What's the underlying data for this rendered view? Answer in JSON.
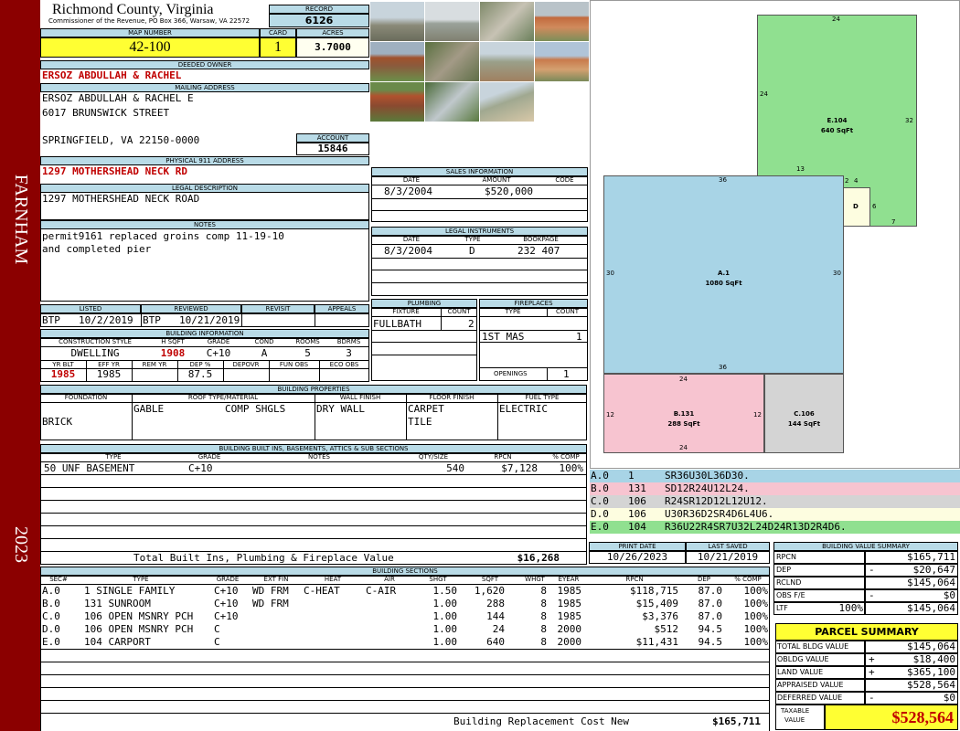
{
  "county": "Richmond County, Virginia",
  "commissioner": "Commissioner of the Revenue, PO Box 366, Warsaw, VA 22572",
  "side_district": "FARNHAM",
  "side_year": "2023",
  "record": {
    "label": "RECORD",
    "value": "6126"
  },
  "map_number": {
    "label": "MAP NUMBER",
    "value": "42-100"
  },
  "card": {
    "label": "CARD",
    "value": "1"
  },
  "acres": {
    "label": "ACRES",
    "value": "3.7000"
  },
  "deeded_owner": {
    "label": "DEEDED OWNER",
    "value": "ERSOZ ABDULLAH & RACHEL"
  },
  "mailing_address": {
    "label": "MAILING ADDRESS",
    "line1": "ERSOZ ABDULLAH & RACHEL E",
    "line2": "6017 BRUNSWICK STREET",
    "line3": "SPRINGFIELD, VA 22150-0000"
  },
  "account": {
    "label": "ACCOUNT",
    "value": "15846"
  },
  "physical_address": {
    "label": "PHYSICAL 911 ADDRESS",
    "value": "1297 MOTHERSHEAD NECK RD"
  },
  "legal_description": {
    "label": "LEGAL DESCRIPTION",
    "value": "1297 MOTHERSHEAD NECK ROAD"
  },
  "notes": {
    "label": "NOTES",
    "line1": "permit9161 replaced groins comp 11-19-10",
    "line2": "and completed pier"
  },
  "sales": {
    "label": "SALES INFORMATION",
    "headers": [
      "DATE",
      "AMOUNT",
      "CODE"
    ],
    "rows": [
      {
        "date": "8/3/2004",
        "amount": "$520,000",
        "code": ""
      }
    ]
  },
  "legal_instruments": {
    "label": "LEGAL INSTRUMENTS",
    "headers": [
      "DATE",
      "TYPE",
      "BOOKPAGE"
    ],
    "rows": [
      {
        "date": "8/3/2004",
        "type": "D",
        "bookpage": "232 407"
      }
    ]
  },
  "plumbing": {
    "label": "PLUMBING",
    "headers": [
      "FIXTURE",
      "COUNT"
    ],
    "fixture": "FULLBATH",
    "count": "2"
  },
  "fireplaces": {
    "label": "FIREPLACES",
    "headers": [
      "TYPE",
      "COUNT"
    ],
    "type": "1ST MAS",
    "count": "1",
    "openings_label": "OPENINGS",
    "openings": "1"
  },
  "review": {
    "headers": [
      "LISTED",
      "REVIEWED",
      "REVISIT",
      "APPEALS"
    ],
    "listed_by": "BTP",
    "listed_date": "10/2/2019",
    "reviewed_by": "BTP",
    "reviewed_date": "10/21/2019",
    "revisit": "",
    "appeals": ""
  },
  "building_info": {
    "label": "BUILDING INFORMATION",
    "headers1": [
      "CONSTRUCTION STYLE",
      "H SQFT",
      "GRADE",
      "COND",
      "ROOMS",
      "BDRMS"
    ],
    "style": "DWELLING",
    "hsqft": "1908",
    "grade": "C+10",
    "cond": "A",
    "rooms": "5",
    "bdrms": "3",
    "headers2": [
      "YR BLT",
      "EFF YR",
      "REM YR",
      "DEP %",
      "DEPOVR",
      "FUN OBS",
      "ECO OBS"
    ],
    "yr_blt": "1985",
    "eff_yr": "1985",
    "rem_yr": "",
    "dep": "87.5",
    "depovr": "",
    "fun_obs": "",
    "eco_obs": ""
  },
  "building_properties": {
    "label": "BUILDING PROPERTIES",
    "headers": [
      "FOUNDATION",
      "ROOF TYPE/MATERIAL",
      "WALL FINISH",
      "FLOOR FINISH",
      "FUEL TYPE"
    ],
    "foundation": "BRICK",
    "roof_type": "GABLE",
    "roof_material": "COMP SHGLS",
    "wall": "DRY WALL",
    "floor1": "CARPET",
    "floor2": "TILE",
    "fuel": "ELECTRIC"
  },
  "builtins": {
    "label": "BUILDING BUILT INS, BASEMENTS, ATTICS & SUB SECTIONS",
    "headers": [
      "TYPE",
      "GRADE",
      "NOTES",
      "QTY/SIZE",
      "RPCN",
      "% COMP"
    ],
    "rows": [
      {
        "type": "50 UNF BASEMENT",
        "grade": "C+10",
        "notes": "",
        "qty": "540",
        "rpcn": "$7,128",
        "comp": "100%"
      }
    ],
    "total_label": "Total Built Ins, Plumbing & Fireplace Value",
    "total_value": "$16,268"
  },
  "sketch_legend": [
    {
      "code": "A.0",
      "num": "1",
      "desc": "SR36U30L36D30.",
      "color": "#a8d4e6"
    },
    {
      "code": "B.0",
      "num": "131",
      "desc": "SD12R24U12L24.",
      "color": "#f7c4d0"
    },
    {
      "code": "C.0",
      "num": "106",
      "desc": "R24SR12D12L12U12.",
      "color": "#d4d4d4"
    },
    {
      "code": "D.0",
      "num": "106",
      "desc": "U30R36D2SR4D6L4U6.",
      "color": "#fdfde0"
    },
    {
      "code": "E.0",
      "num": "104",
      "desc": "R36U22R4SR7U32L24D24R13D2R4D6.",
      "color": "#90e090"
    }
  ],
  "sketch": {
    "a": {
      "name": "A.1",
      "area": "1080 SqFt",
      "top": "36",
      "bottom": "36",
      "left": "30",
      "right": "30"
    },
    "b": {
      "name": "B.131",
      "area": "288 SqFt",
      "top": "24",
      "bottom": "24",
      "left": "12",
      "right": "12"
    },
    "c": {
      "name": "C.106",
      "area": "144 SqFt"
    },
    "d": {
      "name": "D",
      "w1": "2",
      "w2": "4",
      "h": "6"
    },
    "e": {
      "name": "E.104",
      "area": "640 SqFt",
      "top": "24",
      "left": "24",
      "right": "32",
      "inner": "13",
      "bottom": "7"
    }
  },
  "print_date": {
    "label": "PRINT DATE",
    "value": "10/26/2023"
  },
  "last_saved": {
    "label": "LAST SAVED",
    "value": "10/21/2019"
  },
  "building_sections": {
    "label": "BUILDING SECTIONS",
    "headers": [
      "SEC#",
      "TYPE",
      "GRADE",
      "EXT FIN",
      "HEAT",
      "AIR",
      "SHGT",
      "SQFT",
      "WHGT",
      "EYEAR",
      "RPCN",
      "DEP",
      "% COMP"
    ],
    "rows": [
      {
        "sec": "A.0",
        "type": "1 SINGLE FAMILY",
        "grade": "C+10",
        "ext": "WD FRM",
        "heat": "C-HEAT",
        "air": "C-AIR",
        "shgt": "1.50",
        "sqft": "1,620",
        "whgt": "8",
        "eyear": "1985",
        "rpcn": "$118,715",
        "dep": "87.0",
        "comp": "100%"
      },
      {
        "sec": "B.0",
        "type": "131 SUNROOM",
        "grade": "C+10",
        "ext": "WD FRM",
        "heat": "",
        "air": "",
        "shgt": "1.00",
        "sqft": "288",
        "whgt": "8",
        "eyear": "1985",
        "rpcn": "$15,409",
        "dep": "87.0",
        "comp": "100%"
      },
      {
        "sec": "C.0",
        "type": "106 OPEN MSNRY PCH",
        "grade": "C+10",
        "ext": "",
        "heat": "",
        "air": "",
        "shgt": "1.00",
        "sqft": "144",
        "whgt": "8",
        "eyear": "1985",
        "rpcn": "$3,376",
        "dep": "87.0",
        "comp": "100%"
      },
      {
        "sec": "D.0",
        "type": "106 OPEN MSNRY PCH",
        "grade": "C",
        "ext": "",
        "heat": "",
        "air": "",
        "shgt": "1.00",
        "sqft": "24",
        "whgt": "8",
        "eyear": "2000",
        "rpcn": "$512",
        "dep": "94.5",
        "comp": "100%"
      },
      {
        "sec": "E.0",
        "type": "104 CARPORT",
        "grade": "C",
        "ext": "",
        "heat": "",
        "air": "",
        "shgt": "1.00",
        "sqft": "640",
        "whgt": "8",
        "eyear": "2000",
        "rpcn": "$11,431",
        "dep": "94.5",
        "comp": "100%"
      }
    ],
    "total_label": "Building Replacement Cost New",
    "total_value": "$165,711"
  },
  "value_summary": {
    "label": "BUILDING VALUE SUMMARY",
    "rows": [
      {
        "label": "RPCN",
        "pct": "",
        "sign": "",
        "value": "$165,711"
      },
      {
        "label": "DEP",
        "pct": "",
        "sign": "-",
        "value": "$20,647"
      },
      {
        "label": "RCLND",
        "pct": "",
        "sign": "",
        "value": "$145,064"
      },
      {
        "label": "OBS F/E",
        "pct": "",
        "sign": "-",
        "value": "$0"
      },
      {
        "label": "LTF",
        "pct": "100%",
        "sign": "",
        "value": "$145,064"
      }
    ]
  },
  "parcel_summary": {
    "label": "PARCEL SUMMARY",
    "rows": [
      {
        "label": "TOTAL BLDG VALUE",
        "sign": "",
        "value": "$145,064"
      },
      {
        "label": "OBLDG VALUE",
        "sign": "+",
        "value": "$18,400"
      },
      {
        "label": "LAND VALUE",
        "sign": "+",
        "value": "$365,100"
      },
      {
        "label": "APPRAISED VALUE",
        "sign": "",
        "value": "$528,564"
      },
      {
        "label": "DEFERRED VALUE",
        "sign": "-",
        "value": "$0"
      }
    ],
    "taxable_label1": "TAXABLE",
    "taxable_label2": "VALUE",
    "taxable_value": "$528,564"
  },
  "colors": {
    "header_bg": "#b9dbe7",
    "side_bar": "#8b0000",
    "highlight": "#ffff33",
    "red_text": "#c00000"
  }
}
